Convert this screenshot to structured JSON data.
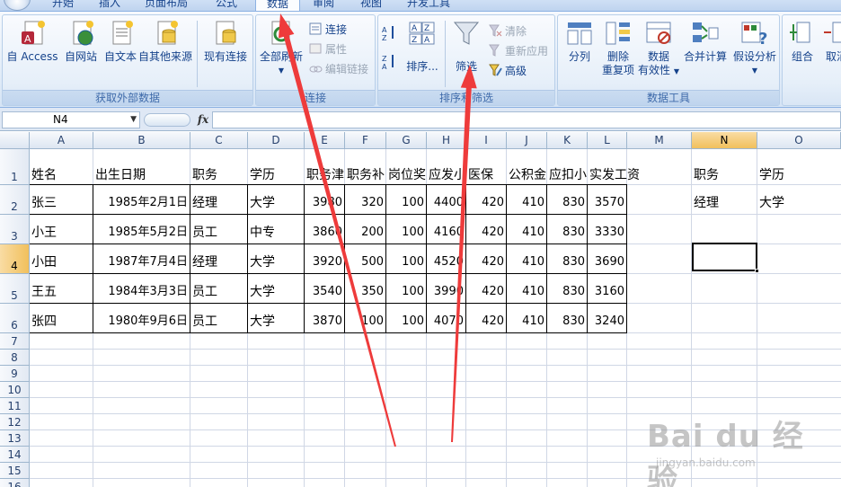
{
  "tabs": [
    {
      "label": "开始",
      "active": false
    },
    {
      "label": "插入",
      "active": false
    },
    {
      "label": "页面布局",
      "active": false
    },
    {
      "label": "公式",
      "active": false
    },
    {
      "label": "数据",
      "active": true
    },
    {
      "label": "审阅",
      "active": false
    },
    {
      "label": "视图",
      "active": false
    },
    {
      "label": "开发工具",
      "active": false
    }
  ],
  "ribbon": {
    "external": {
      "label": "获取外部数据",
      "buttons": [
        "自 Access",
        "自网站",
        "自文本",
        "自其他来源",
        "现有连接"
      ]
    },
    "connections": {
      "label": "连接",
      "refresh": "全部刷新",
      "small": [
        "连接",
        "属性",
        "编辑链接"
      ]
    },
    "sort": {
      "label": "排序和筛选",
      "sort_btn": "排序...",
      "filter_btn": "筛选",
      "small": [
        "清除",
        "重新应用",
        "高级"
      ]
    },
    "tools": {
      "label": "数据工具",
      "buttons": [
        [
          "分列"
        ],
        [
          "删除",
          "重复项"
        ],
        [
          "数据",
          "有效性"
        ],
        [
          "合并计算"
        ],
        [
          "假设分析"
        ]
      ]
    },
    "outline": {
      "buttons": [
        "组合",
        "取消"
      ]
    }
  },
  "formula_bar": {
    "name_box": "N4",
    "fx": "fx",
    "formula": ""
  },
  "columns": [
    "A",
    "B",
    "C",
    "D",
    "E",
    "F",
    "G",
    "H",
    "I",
    "J",
    "K",
    "L",
    "M",
    "N",
    "O"
  ],
  "selected_column": "N",
  "rows": [
    "1",
    "2",
    "3",
    "4",
    "5",
    "6",
    "7",
    "8",
    "9",
    "10",
    "11",
    "12",
    "13",
    "14",
    "15",
    "16"
  ],
  "selected_row": "4",
  "table": {
    "header": [
      "姓名",
      "出生日期",
      "职务",
      "学历",
      "职务津",
      "职务补",
      "岗位奖",
      "应发小",
      "医保",
      "公积金",
      "应扣小",
      "实发工资"
    ],
    "records": [
      [
        "张三",
        "1985年2月1日",
        "经理",
        "大学",
        "3980",
        "320",
        "100",
        "4400",
        "420",
        "410",
        "830",
        "3570"
      ],
      [
        "小王",
        "1985年5月2日",
        "员工",
        "中专",
        "3860",
        "200",
        "100",
        "4160",
        "420",
        "410",
        "830",
        "3330"
      ],
      [
        "小田",
        "1987年7月4日",
        "经理",
        "大学",
        "3920",
        "500",
        "100",
        "4520",
        "420",
        "410",
        "830",
        "3690"
      ],
      [
        "王五",
        "1984年3月3日",
        "员工",
        "大学",
        "3540",
        "350",
        "100",
        "3990",
        "420",
        "410",
        "830",
        "3160"
      ],
      [
        "张四",
        "1980年9月6日",
        "员工",
        "大学",
        "3870",
        "100",
        "100",
        "4070",
        "420",
        "410",
        "830",
        "3240"
      ]
    ]
  },
  "criteria": {
    "header": [
      "职务",
      "学历"
    ],
    "values": [
      "经理",
      "大学"
    ]
  },
  "watermark": {
    "main": "Bai du 经验",
    "sub": "jingyan.baidu.com"
  },
  "colors": {
    "arrow": "#ee3b3b",
    "selection": "#f1c05c",
    "ribbon_text": "#15428b"
  }
}
